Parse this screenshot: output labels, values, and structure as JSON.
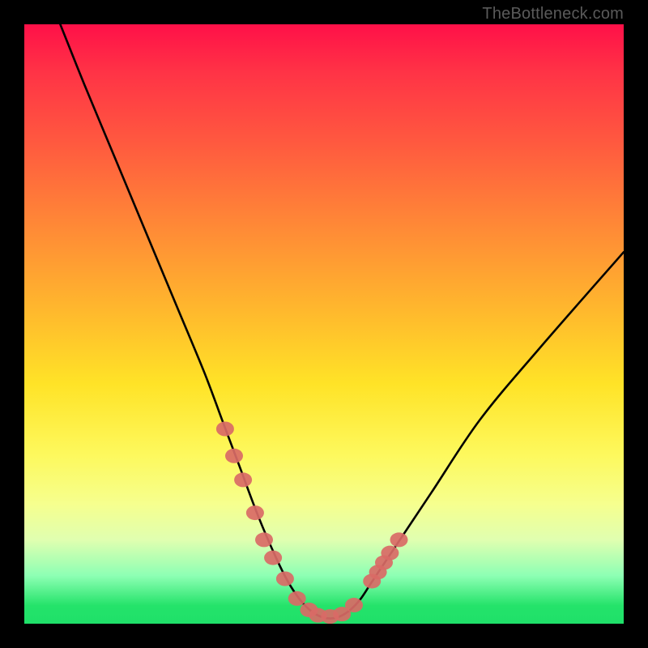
{
  "watermark": "TheBottleneck.com",
  "chart_data": {
    "type": "line",
    "title": "",
    "xlabel": "",
    "ylabel": "",
    "xlim": [
      0,
      100
    ],
    "ylim": [
      0,
      100
    ],
    "series": [
      {
        "name": "bottleneck-curve",
        "x": [
          6,
          10,
          15,
          20,
          25,
          30,
          33,
          36,
          39,
          42,
          44,
          46,
          48,
          50,
          52,
          54,
          56,
          58,
          62,
          68,
          76,
          86,
          100
        ],
        "y": [
          100,
          90,
          78,
          66,
          54,
          42,
          34,
          26,
          18,
          11,
          7,
          4,
          2,
          1,
          1,
          2,
          4,
          7,
          13,
          22,
          34,
          46,
          62
        ]
      }
    ],
    "markers": {
      "name": "highlighted-points",
      "x": [
        33.5,
        35.0,
        36.5,
        38.5,
        40.0,
        41.5,
        43.5,
        45.5,
        47.5,
        49.0,
        51.0,
        53.0,
        55.0,
        58.0,
        59.0,
        60.0,
        61.0,
        62.5
      ],
      "y": [
        32.5,
        28.0,
        24.0,
        18.5,
        14.0,
        11.0,
        7.5,
        4.2,
        2.3,
        1.4,
        1.2,
        1.6,
        3.1,
        7.1,
        8.6,
        10.2,
        11.8,
        14.0
      ]
    },
    "annotations": []
  }
}
